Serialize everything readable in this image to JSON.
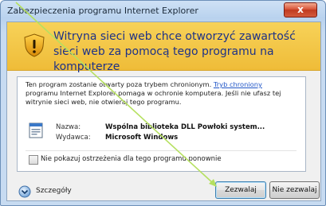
{
  "window": {
    "title": "Zabezpieczenia programu Internet Explorer",
    "close_label": "x"
  },
  "warning": {
    "headline": "Witryna sieci web chce otworzyć zawartość sieci web za pomocą tego programu na komputerze"
  },
  "info": {
    "text_before_link": "Ten program zostanie otwarty poza trybem chronionym. ",
    "link_text": "Tryb chroniony",
    "text_after_link": " programu Internet Explorer pomaga w ochronie komputera. Jeśli nie ufasz tej witrynie sieci web, nie otwieraj tego programu."
  },
  "program": {
    "name_label": "Nazwa:",
    "name_value": "Wspólna biblioteka DLL Powłoki system...",
    "publisher_label": "Wydawca:",
    "publisher_value": "Microsoft Windows"
  },
  "checkbox": {
    "label": "Nie pokazuj ostrzeżenia dla tego programu ponownie",
    "checked": false
  },
  "footer": {
    "details_label": "Szczegóły",
    "allow_label": "Zezwalaj",
    "deny_label": "Nie zezwalaj"
  },
  "colors": {
    "accent_green": "#9bd24a",
    "warning_band": "#f2c744",
    "link": "#1f55c7"
  }
}
